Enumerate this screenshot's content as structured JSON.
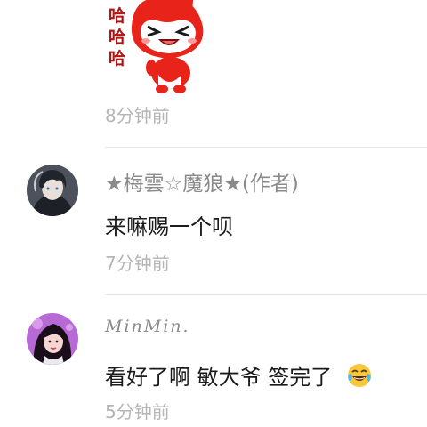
{
  "top_comment": {
    "sticker_text": [
      "哈",
      "哈",
      "哈"
    ],
    "sticker_icon": "laughing-fox-sticker",
    "time": "8分钟前"
  },
  "comments": [
    {
      "username": "★梅雲☆魔狼★(作者)",
      "avatar_icon": "avatar-dark-haired-boy",
      "content": "来嘛赐一个呗",
      "time": "7分钟前"
    },
    {
      "username": "MinMin.",
      "avatar_icon": "avatar-girl",
      "content": "看好了啊 敏大爷 签完了",
      "emoji": "tears-of-joy-emoji",
      "time": "5分钟前"
    }
  ],
  "colors": {
    "timestamp": "#b5b5b5",
    "username": "#8a8a8a",
    "content": "#1a1a1a",
    "divider": "#e6e6e6",
    "sticker_red": "#e8231a"
  }
}
